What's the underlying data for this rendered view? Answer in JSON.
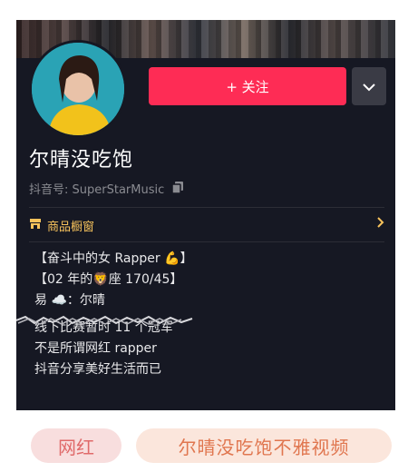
{
  "profile": {
    "name": "尔晴没吃饱",
    "douyin_id": "抖音号: SuperStarMusic",
    "follow_label": "+ 关注"
  },
  "shop": {
    "label": "商品橱窗"
  },
  "bio": {
    "lines": [
      "【奋斗中的女 Rapper 💪】",
      "【02 年的🦁座 170/45】",
      "易 ☁️：尔晴",
      "线下比赛暂时 11 个冠军",
      "不是所谓网红 rapper",
      "抖音分享美好生活而已"
    ]
  },
  "tags": [
    "网红",
    "尔晴没吃饱不雅视频"
  ],
  "colors": {
    "accent": "#fe2c55",
    "background": "#161823",
    "shop": "#f8c35c"
  },
  "icons": [
    "chevron-down-icon",
    "copy-icon",
    "shop-icon",
    "chevron-right-icon",
    "sun-icon"
  ]
}
